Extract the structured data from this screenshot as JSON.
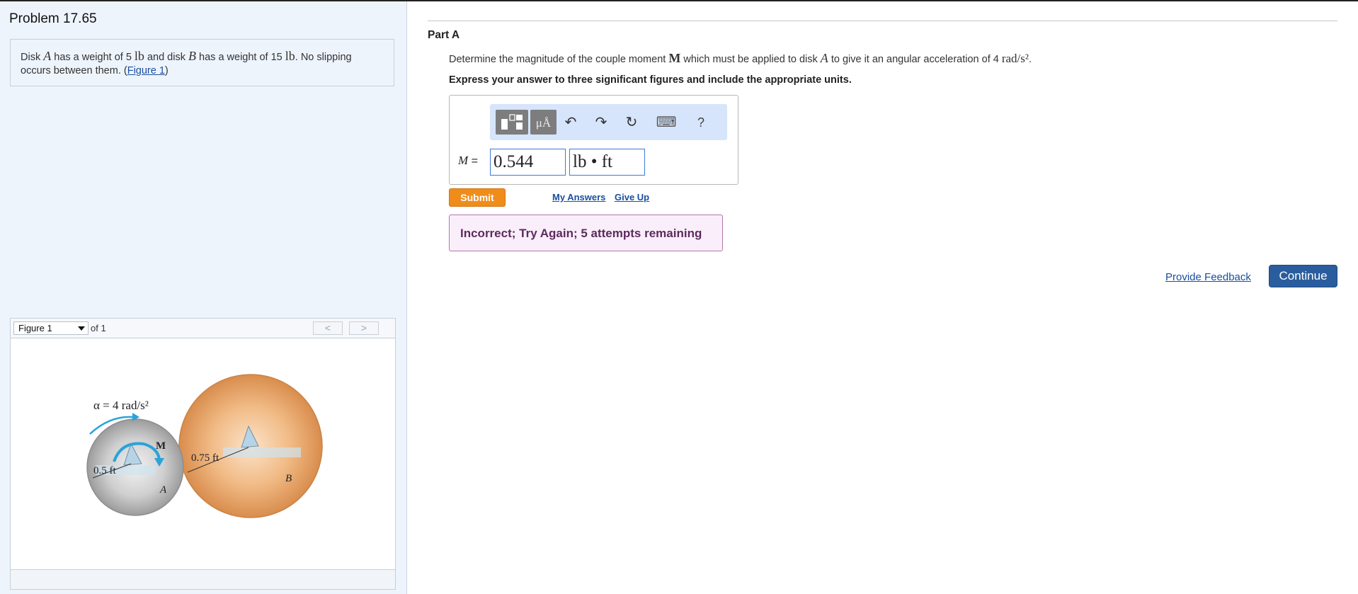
{
  "problem": {
    "title": "Problem 17.65",
    "text_1": "Disk ",
    "disk_a": "A",
    "text_2": " has a weight of 5 ",
    "unit_lb": "lb",
    "text_3": " and disk ",
    "disk_b": "B",
    "text_4": " has a weight of 15 ",
    "unit_lb2": "lb",
    "text_5": ". No slipping occurs between them. (",
    "figure_link": "Figure 1",
    "text_6": ")"
  },
  "figure": {
    "selected": "Figure 1",
    "of_label": "of 1",
    "prev": "<",
    "next": ">",
    "alpha_label": "α = 4 rad/s²",
    "m_label": "M",
    "radius_a": "0.5 ft",
    "radius_b": "0.75 ft",
    "label_a": "A",
    "label_b": "B"
  },
  "part": {
    "title": "Part A",
    "q1": "Determine the magnitude of the couple moment ",
    "q_m": "M",
    "q2": " which must be applied to disk ",
    "q_a": "A",
    "q3": " to give it an angular acceleration of 4 ",
    "q_unit": "rad/s²",
    "q4": ".",
    "instruction": "Express your answer to three significant figures and include the appropriate units."
  },
  "answer": {
    "toolbar": {
      "templates_icon": "templates-icon",
      "units_label": "μÅ",
      "undo_icon": "↶",
      "redo_icon": "↷",
      "reset_icon": "↻",
      "keyboard_icon": "⌨",
      "help_label": "?"
    },
    "var_label": "M",
    "equals": " =",
    "value": "0.544",
    "units": "lb • ft"
  },
  "actions": {
    "submit": "Submit",
    "my_answers": "My Answers",
    "give_up": "Give Up",
    "provide_feedback": "Provide Feedback",
    "continue": "Continue"
  },
  "feedback": {
    "message": "Incorrect; Try Again; 5 attempts remaining"
  },
  "colors": {
    "accent_submit": "#f08d1a",
    "continue_bg": "#2a5d9e",
    "feedback_bg": "#fbeefb",
    "link": "#1a4fa0"
  }
}
